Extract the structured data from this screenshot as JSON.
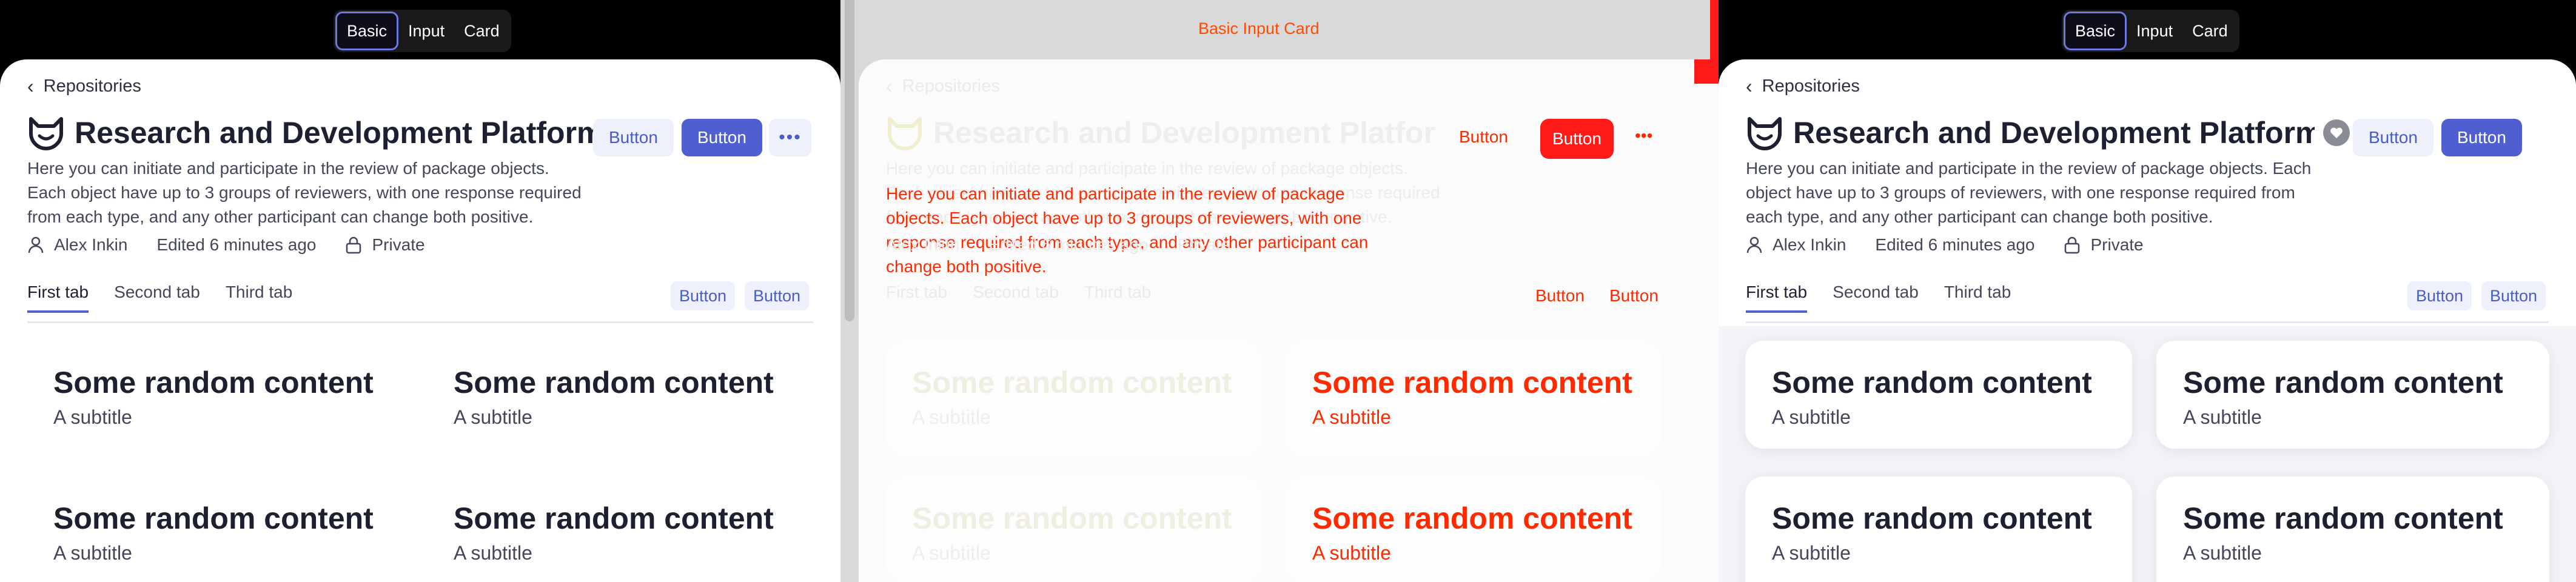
{
  "segment": {
    "options": [
      "Basic",
      "Input",
      "Card"
    ],
    "active": "Basic",
    "ghost_label": "Basic Input Card"
  },
  "breadcrumb": {
    "label": "Repositories"
  },
  "header": {
    "title": "Research and Development Platform",
    "buttons": {
      "light": "Button",
      "solid": "Button",
      "more": "•••"
    }
  },
  "description": "Here you can initiate and participate in the review of package objects. Each object have up to 3 groups of reviewers, with one response required from each type, and any other participant can change both positive.",
  "meta": {
    "author": "Alex Inkin",
    "edited": "Edited 6 minutes ago",
    "visibility": "Private"
  },
  "tabs": {
    "items": [
      "First tab",
      "Second tab",
      "Third tab"
    ],
    "active": "First tab",
    "actions": [
      "Button",
      "Button"
    ]
  },
  "cards": [
    {
      "title": "Some random content",
      "subtitle": "A subtitle"
    },
    {
      "title": "Some random content",
      "subtitle": "A subtitle"
    },
    {
      "title": "Some random content",
      "subtitle": "A subtitle"
    },
    {
      "title": "Some random content",
      "subtitle": "A subtitle"
    }
  ],
  "colors": {
    "accent": "#4f5fcf",
    "accent_light": "#eef0fb",
    "diff_red": "#ff1a1a"
  },
  "icons": [
    "chevron-left-icon",
    "logo-icon",
    "heart-badge-icon",
    "more-icon",
    "user-icon",
    "lock-icon"
  ]
}
